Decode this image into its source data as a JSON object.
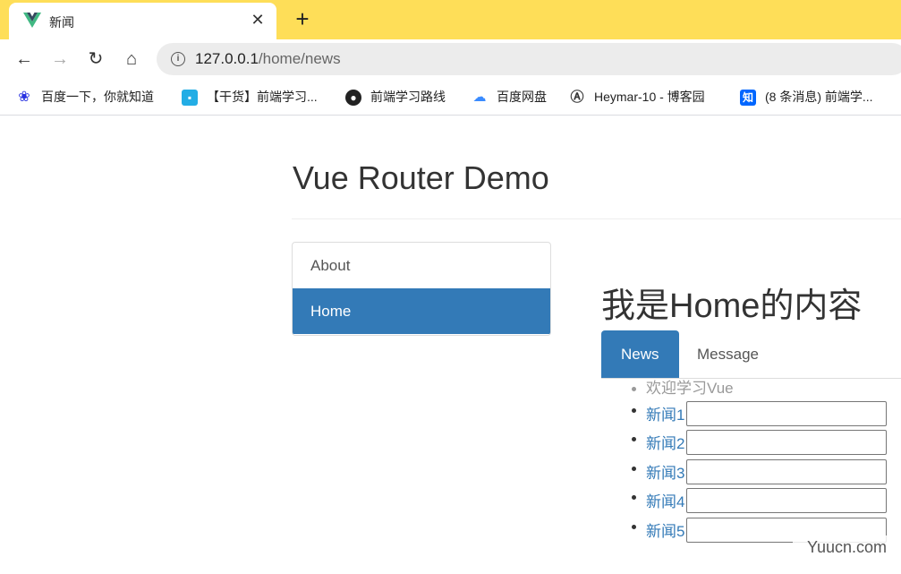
{
  "browser": {
    "tab_title": "新闻",
    "close_glyph": "✕",
    "newtab_glyph": "+",
    "back_glyph": "←",
    "forward_glyph": "→",
    "reload_glyph": "↻",
    "home_glyph": "⌂",
    "info_glyph": "i",
    "url_host": "127.0.0.1",
    "url_path": "/home/news",
    "bookmarks": [
      {
        "label": "百度一下，你就知道",
        "icon": "baidu-paw-icon"
      },
      {
        "label": "【干货】前端学习...",
        "icon": "bilibili-icon"
      },
      {
        "label": "前端学习路线",
        "icon": "globe-icon"
      },
      {
        "label": "百度网盘",
        "icon": "baidu-netdisk-icon"
      },
      {
        "label": "Heymar-10 - 博客园",
        "icon": "cnblogs-icon"
      },
      {
        "label": "(8 条消息) 前端学...",
        "icon": "zhihu-icon"
      }
    ]
  },
  "page": {
    "title": "Vue Router Demo",
    "nav": [
      "About",
      "Home"
    ],
    "home_heading": "我是Home的内容",
    "subtabs": [
      "News",
      "Message"
    ],
    "welcome": "欢迎学习Vue",
    "news": [
      "新闻1",
      "新闻2",
      "新闻3",
      "新闻4",
      "新闻5"
    ]
  },
  "watermark": "Yuucn.com",
  "colors": {
    "tabstrip": "#fede58",
    "accent": "#337ab7",
    "link": "#337ab7"
  }
}
